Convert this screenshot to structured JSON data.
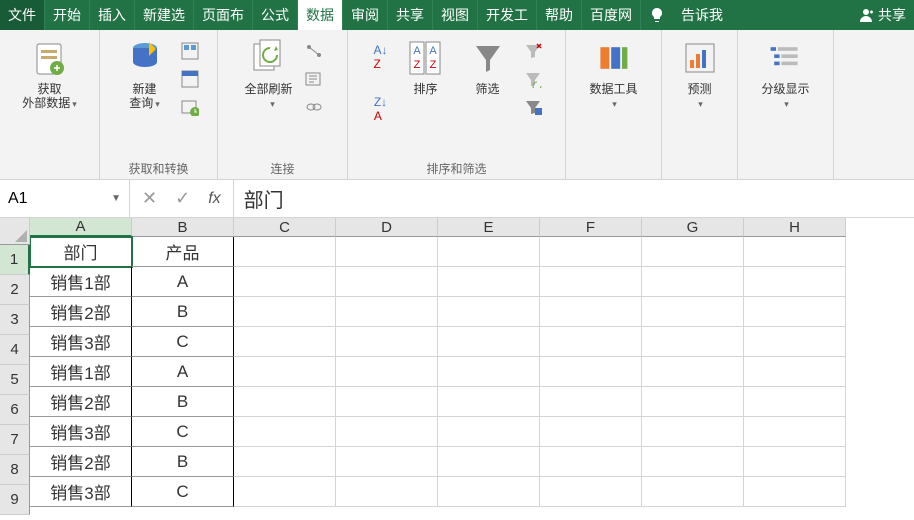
{
  "menu": {
    "file": "文件",
    "tabs": [
      "开始",
      "插入",
      "新建选",
      "页面布",
      "公式",
      "数据",
      "审阅",
      "共享",
      "视图",
      "开发工",
      "帮助",
      "百度网"
    ],
    "active_index": 5,
    "tell_me": "告诉我",
    "share": "共享"
  },
  "ribbon": {
    "groups": [
      {
        "label": "",
        "big": [
          {
            "icon": "ext-data",
            "label_line1": "获取",
            "label_line2": "外部数据",
            "drop": true
          }
        ]
      },
      {
        "label": "获取和转换",
        "big": [
          {
            "icon": "new-query",
            "label_line1": "新建",
            "label_line2": "查询",
            "drop": true
          }
        ]
      },
      {
        "label": "连接",
        "big": [
          {
            "icon": "refresh-all",
            "label_line1": "全部刷新",
            "label_line2": "",
            "drop": true
          }
        ]
      },
      {
        "label": "排序和筛选",
        "big": [
          {
            "icon": "sort",
            "label_line1": "排序",
            "label_line2": "",
            "drop": false
          },
          {
            "icon": "filter",
            "label_line1": "筛选",
            "label_line2": "",
            "drop": false
          }
        ]
      },
      {
        "label": "",
        "big": [
          {
            "icon": "data-tools",
            "label_line1": "数据工具",
            "label_line2": "",
            "drop": true
          }
        ]
      },
      {
        "label": "",
        "big": [
          {
            "icon": "forecast",
            "label_line1": "预测",
            "label_line2": "",
            "drop": true
          }
        ]
      },
      {
        "label": "",
        "big": [
          {
            "icon": "outline",
            "label_line1": "分级显示",
            "label_line2": "",
            "drop": true
          }
        ]
      }
    ]
  },
  "formula_bar": {
    "name_box": "A1",
    "content": "部门"
  },
  "grid": {
    "columns": [
      "A",
      "B",
      "C",
      "D",
      "E",
      "F",
      "G",
      "H"
    ],
    "selected_cell": "A1",
    "rows": [
      {
        "num": 1,
        "cells": [
          "部门",
          "产品"
        ]
      },
      {
        "num": 2,
        "cells": [
          "销售1部",
          "A"
        ]
      },
      {
        "num": 3,
        "cells": [
          "销售2部",
          "B"
        ]
      },
      {
        "num": 4,
        "cells": [
          "销售3部",
          "C"
        ]
      },
      {
        "num": 5,
        "cells": [
          "销售1部",
          "A"
        ]
      },
      {
        "num": 6,
        "cells": [
          "销售2部",
          "B"
        ]
      },
      {
        "num": 7,
        "cells": [
          "销售3部",
          "C"
        ]
      },
      {
        "num": 8,
        "cells": [
          "销售2部",
          "B"
        ]
      },
      {
        "num": 9,
        "cells": [
          "销售3部",
          "C"
        ]
      }
    ]
  }
}
